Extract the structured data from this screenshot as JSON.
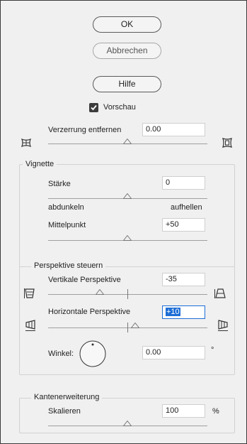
{
  "buttons": {
    "ok": "OK",
    "cancel": "Abbrechen",
    "help": "Hilfe"
  },
  "preview": {
    "label": "Vorschau",
    "checked": true
  },
  "distortion": {
    "label": "Verzerrung entfernen",
    "value": "0.00",
    "slider_fraction": 0.5
  },
  "vignette": {
    "title": "Vignette",
    "amount_label": "Stärke",
    "amount_value": "0",
    "amount_slider_fraction": 0.5,
    "darken_label": "abdunkeln",
    "lighten_label": "aufhellen",
    "midpoint_label": "Mittelpunkt",
    "midpoint_value": "+50",
    "midpoint_slider_fraction": 0.5
  },
  "perspective": {
    "title": "Perspektive steuern",
    "vertical_label": "Vertikale Perspektive",
    "vertical_value": "-35",
    "vertical_slider_fraction": 0.325,
    "horizontal_label": "Horizontale Perspektive",
    "horizontal_value": "+10",
    "horizontal_slider_fraction": 0.55,
    "angle_label": "Winkel:",
    "angle_value": "0.00",
    "angle_unit": "°"
  },
  "edge": {
    "title": "Kantenerweiterung",
    "scale_label": "Skalieren",
    "scale_value": "100",
    "scale_unit": "%",
    "scale_slider_fraction": 0.5
  },
  "icons": {
    "distortion_left": "pincushion-grid-icon",
    "distortion_right": "barrel-frame-icon",
    "vertical_left": "vertical-perspective-narrow-icon",
    "vertical_right": "vertical-perspective-wide-icon",
    "horizontal_left": "horizontal-perspective-left-icon",
    "horizontal_right": "horizontal-perspective-right-icon"
  }
}
